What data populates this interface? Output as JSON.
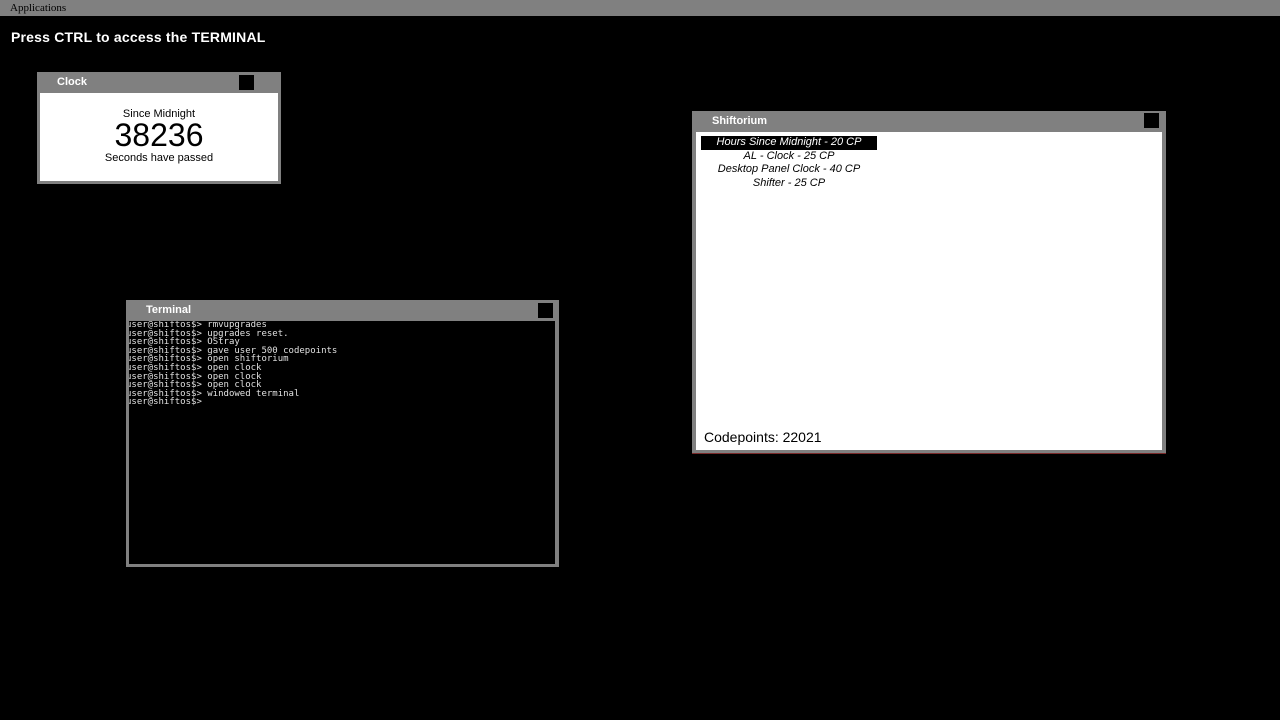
{
  "menubar": {
    "applications_label": "Applications"
  },
  "hint": "Press CTRL to access the TERMINAL",
  "clock": {
    "title": "Clock",
    "since_label": "Since Midnight",
    "seconds": "38236",
    "passed_label": "Seconds have passed"
  },
  "shiftorium": {
    "title": "Shiftorium",
    "items": [
      {
        "label": "Hours Since Midnight - 20 CP",
        "selected": true
      },
      {
        "label": "AL - Clock - 25 CP",
        "selected": false
      },
      {
        "label": "Desktop Panel Clock - 40 CP",
        "selected": false
      },
      {
        "label": "Shifter - 25 CP",
        "selected": false
      }
    ],
    "codepoints_label": "Codepoints: 22021"
  },
  "terminal": {
    "title": "Terminal",
    "lines": [
      "user@shiftos$> rmvupgrades",
      "user@shiftos$> upgrades reset.",
      "user@shiftos$> OStray",
      "user@shiftos$> gave user 500 codepoints",
      "user@shiftos$> open shiftorium",
      "user@shiftos$> open clock",
      "user@shiftos$> open clock",
      "user@shiftos$> open clock",
      "user@shiftos$> windowed terminal",
      "user@shiftos$>"
    ]
  },
  "colors": {
    "desktop_bg": "#000000",
    "window_chrome": "#808080",
    "selection_bg": "#000000",
    "terminal_text": "#e0e0e0"
  }
}
